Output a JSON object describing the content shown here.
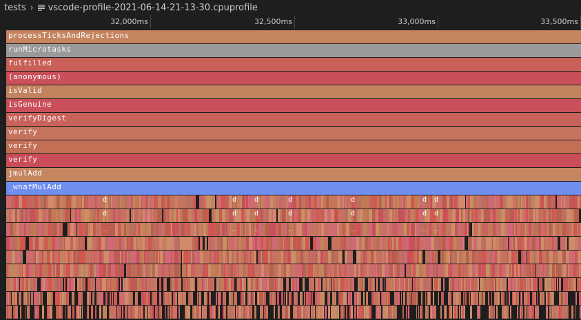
{
  "breadcrumb": {
    "folder": "tests",
    "file": "vscode-profile-2021-06-14-21-13-30.cpuprofile",
    "file_icon": "list-icon"
  },
  "timeline": {
    "ticks": [
      "32,000ms",
      "32,500ms",
      "33,000ms",
      "33,500ms"
    ]
  },
  "frames": [
    {
      "label": "processTicksAndRejections",
      "color": "#c48560"
    },
    {
      "label": "runMicrotasks",
      "color": "#9a9a9a"
    },
    {
      "label": "fulfilled",
      "color": "#c86058"
    },
    {
      "label": "(anonymous)",
      "color": "#c94f5a"
    },
    {
      "label": "isValid",
      "color": "#c4835f"
    },
    {
      "label": "isGenuine",
      "color": "#c9505b"
    },
    {
      "label": "verifyDigest",
      "color": "#c8625b"
    },
    {
      "label": "verify",
      "color": "#c5735c"
    },
    {
      "label": "verify",
      "color": "#c26f55"
    },
    {
      "label": "verify",
      "color": "#ca4c58"
    },
    {
      "label": "jmulAdd",
      "color": "#c48560"
    },
    {
      "label": "_wnafMulAdd",
      "color": "#6e8ef0"
    }
  ],
  "small_labels": {
    "row1": "d",
    "row2": "d",
    "row3": "_"
  }
}
